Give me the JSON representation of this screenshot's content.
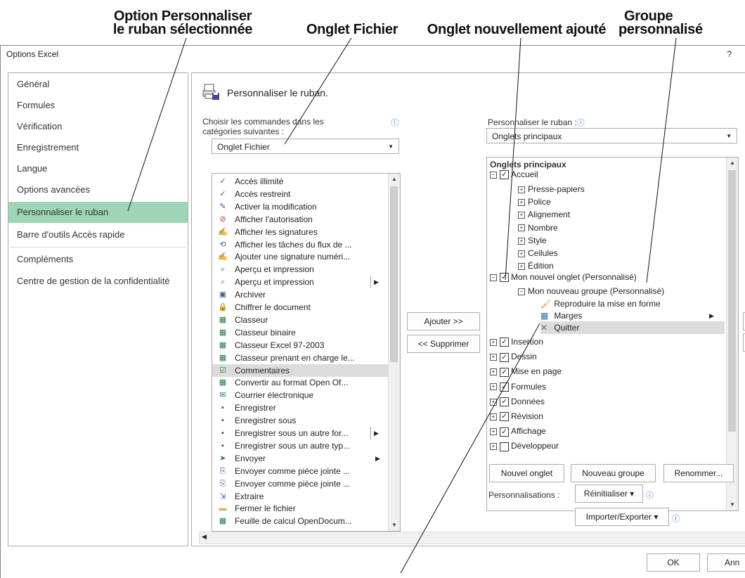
{
  "callouts": {
    "personnaliser_line1": "Option Personnaliser",
    "personnaliser_line2": "le ruban sélectionnée",
    "fichier": "Onglet Fichier",
    "nouvel_onglet": "Onglet nouvellement ajouté",
    "groupe_line1": "Groupe",
    "groupe_line2": "personnalisé"
  },
  "window": {
    "title": "Options Excel",
    "help": "?"
  },
  "nav": {
    "items": [
      "Général",
      "Formules",
      "Vérification",
      "Enregistrement",
      "Langue",
      "Options avancées",
      "Personnaliser le ruban",
      "Barre d'outils Accès rapide",
      "Compléments",
      "Centre de gestion de la confidentialité"
    ],
    "selected": "Personnaliser le ruban"
  },
  "content": {
    "heading": "Personnaliser le ruban.",
    "choose_label_line1": "Choisir les commandes dans les",
    "choose_label_line2": "catégories suivantes :",
    "choose_value": "Onglet Fichier",
    "customize_label": "Personnaliser le ruban :",
    "customize_value": "Onglets principaux"
  },
  "commands": [
    {
      "label": "Accès illimité",
      "icon": "check-icon"
    },
    {
      "label": "Accès restreint",
      "icon": "check-icon"
    },
    {
      "label": "Activer la modification",
      "icon": "edit-icon"
    },
    {
      "label": "Afficher l'autorisation",
      "icon": "permission-icon"
    },
    {
      "label": "Afficher les signatures",
      "icon": "signature-icon"
    },
    {
      "label": "Afficher les tâches du flux de ...",
      "icon": "workflow-icon"
    },
    {
      "label": "Ajouter une signature numéri...",
      "icon": "signature-add-icon"
    },
    {
      "label": "Aperçu et impression",
      "icon": "preview-icon"
    },
    {
      "label": "Aperçu et impression",
      "icon": "preview-icon",
      "submenu": true
    },
    {
      "label": "Archiver",
      "icon": "archive-icon"
    },
    {
      "label": "Chiffrer le document",
      "icon": "lock-icon"
    },
    {
      "label": "Classeur",
      "icon": "workbook-icon"
    },
    {
      "label": "Classeur binaire",
      "icon": "workbook-icon"
    },
    {
      "label": "Classeur Excel 97-2003",
      "icon": "workbook-icon"
    },
    {
      "label": "Classeur prenant en charge le...",
      "icon": "workbook-icon"
    },
    {
      "label": "Commentaires",
      "icon": "comment-icon",
      "selected": true
    },
    {
      "label": "Convertir au format Open Of...",
      "icon": "workbook-icon"
    },
    {
      "label": "Courrier électronique",
      "icon": "mail-icon"
    },
    {
      "label": "Enregistrer",
      "icon": "save-icon"
    },
    {
      "label": "Enregistrer sous",
      "icon": "save-as-icon"
    },
    {
      "label": "Enregistrer sous un autre for...",
      "icon": "save-as-icon",
      "submenu": true
    },
    {
      "label": "Enregistrer sous un autre typ...",
      "icon": "save-as-icon"
    },
    {
      "label": "Envoyer",
      "icon": "send-icon",
      "arrow": true
    },
    {
      "label": "Envoyer comme pièce jointe ...",
      "icon": "attachment-icon"
    },
    {
      "label": "Envoyer comme pièce jointe ...",
      "icon": "attachment-icon"
    },
    {
      "label": "Extraire",
      "icon": "extract-icon"
    },
    {
      "label": "Fermer le fichier",
      "icon": "folder-icon"
    },
    {
      "label": "Feuille de calcul OpenDocum...",
      "icon": "workbook-icon"
    }
  ],
  "middle_buttons": {
    "add": "Ajouter >>",
    "remove": "<< Supprimer"
  },
  "tree": {
    "header": "Onglets principaux",
    "accueil": "Accueil",
    "accueil_groups": [
      "Presse-papiers",
      "Police",
      "Alignement",
      "Nombre",
      "Style",
      "Cellules",
      "Édition"
    ],
    "new_tab": "Mon nouvel onglet (Personnalisé)",
    "new_group": "Mon nouveau groupe (Personnalisé)",
    "new_group_items": [
      "Reproduire la mise en forme",
      "Marges",
      "Quitter"
    ],
    "tabs": [
      {
        "label": "Insertion",
        "checked": true
      },
      {
        "label": "Dessin",
        "checked": true
      },
      {
        "label": "Mise en page",
        "checked": true
      },
      {
        "label": "Formules",
        "checked": true
      },
      {
        "label": "Données",
        "checked": true
      },
      {
        "label": "Révision",
        "checked": true
      },
      {
        "label": "Affichage",
        "checked": true
      },
      {
        "label": "Développeur",
        "checked": false
      }
    ]
  },
  "bottom": {
    "new_tab_btn": "Nouvel onglet",
    "new_group_btn": "Nouveau groupe",
    "rename_btn": "Renommer...",
    "custom_label": "Personnalisations :",
    "reset_btn": "Réinitialiser ▾",
    "import_btn": "Importer/Exporter ▾",
    "ok": "OK",
    "cancel": "Ann"
  }
}
